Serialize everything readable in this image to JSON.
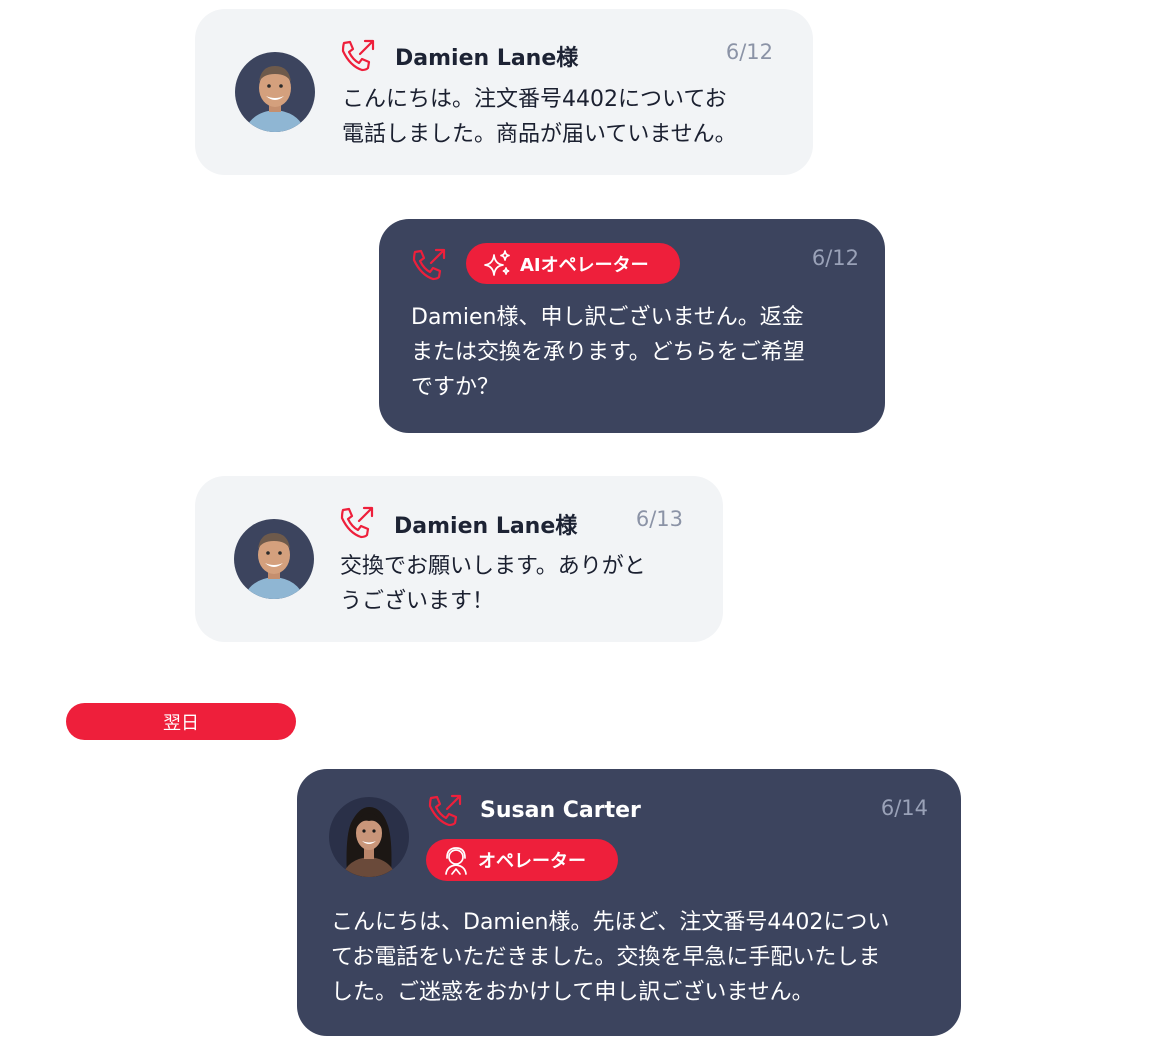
{
  "colors": {
    "accent": "#ee1f3b",
    "dark_card": "#3c445e",
    "light_card": "#f2f4f6"
  },
  "messages": [
    {
      "sender": "Damien Lane様",
      "date": "6/12",
      "text": "こんにちは。注文番号4402についてお\n電話しました。商品が届いていません。",
      "icon": "phone-outgoing-icon"
    },
    {
      "badge": "AIオペレーター",
      "badge_icon": "sparkle-icon",
      "date": "6/12",
      "text": "Damien様、申し訳ございません。返金\nまたは交換を承ります。どちらをご希望\nですか？",
      "icon": "phone-outgoing-icon"
    },
    {
      "sender": "Damien Lane様",
      "date": "6/13",
      "text": "交換でお願いします。ありがと\nうございます！",
      "icon": "phone-outgoing-icon"
    },
    {
      "sender": "Susan Carter",
      "badge": "オペレーター",
      "badge_icon": "operator-headset-icon",
      "date": "6/14",
      "text": "こんにちは、Damien様。先ほど、注文番号4402につい\nてお電話をいただきました。交換を早急に手配いたしま\nした。ご迷惑をおかけして申し訳ございません。",
      "icon": "phone-outgoing-icon"
    }
  ],
  "divider": {
    "label": "翌日"
  }
}
